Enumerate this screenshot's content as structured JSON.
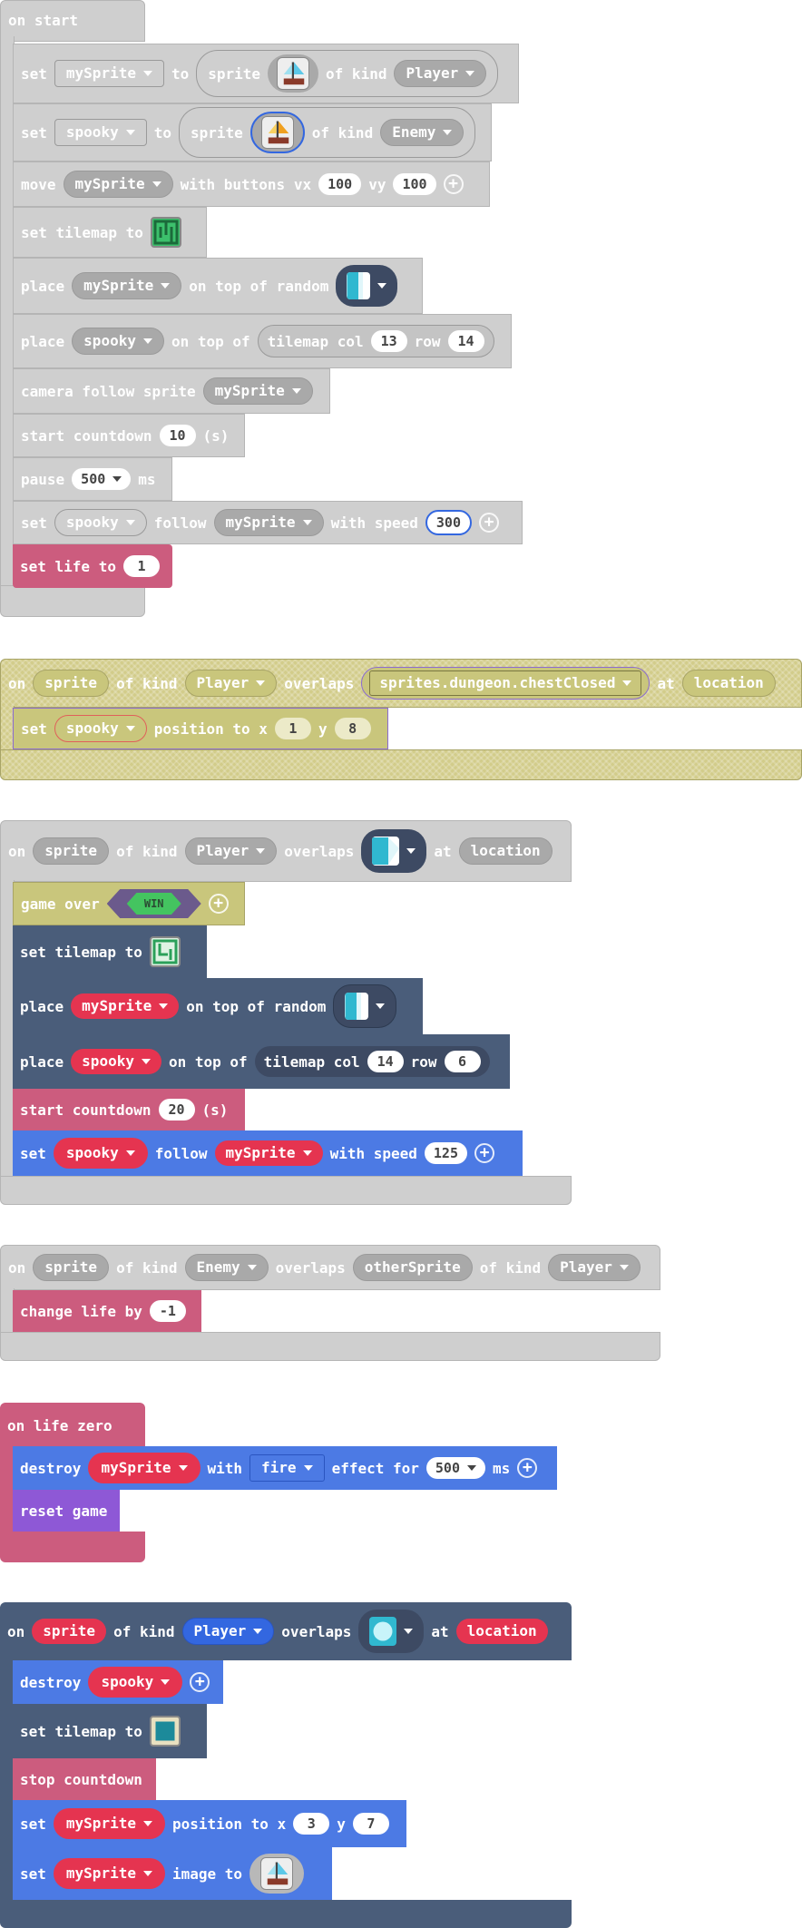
{
  "s1": {
    "hat": "on start",
    "set": "set",
    "to": "to",
    "sprite": "sprite",
    "of_kind": "of kind",
    "mySprite": "mySprite",
    "Player": "Player",
    "spooky": "spooky",
    "Enemy": "Enemy",
    "move": "move",
    "with_buttons": "with buttons vx",
    "vx": "100",
    "vy_lbl": "vy",
    "vy": "100",
    "set_tilemap": "set tilemap to",
    "place": "place",
    "on_top_random": "on top of random",
    "on_top_of": "on top of",
    "tilemap_col": "tilemap col",
    "col": "13",
    "row_lbl": "row",
    "row": "14",
    "camera": "camera follow sprite",
    "start_countdown": "start countdown",
    "countdown": "10",
    "s": "(s)",
    "pause": "pause",
    "pause_val": "500",
    "ms": "ms",
    "follow": "follow",
    "with_speed": "with speed",
    "speed": "300",
    "set_life": "set life to",
    "life": "1"
  },
  "s2": {
    "on": "on",
    "sprite": "sprite",
    "of_kind": "of kind",
    "Player": "Player",
    "overlaps": "overlaps",
    "tile": "sprites.dungeon.chestClosed",
    "at": "at",
    "location": "location",
    "set": "set",
    "spooky": "spooky",
    "position_to_x": "position to x",
    "x": "1",
    "y_lbl": "y",
    "y": "8"
  },
  "s3": {
    "on": "on",
    "sprite": "sprite",
    "of_kind": "of kind",
    "Player": "Player",
    "overlaps": "overlaps",
    "at": "at",
    "location": "location",
    "game_over": "game over",
    "win": "WIN",
    "set_tilemap": "set tilemap to",
    "place": "place",
    "mySprite": "mySprite",
    "on_top_random": "on top of random",
    "spooky": "spooky",
    "on_top_of": "on top of",
    "tilemap_col": "tilemap col",
    "col": "14",
    "row_lbl": "row",
    "row": "6",
    "start_countdown": "start countdown",
    "countdown": "20",
    "s": "(s)",
    "set": "set",
    "follow": "follow",
    "with_speed": "with speed",
    "speed": "125"
  },
  "s4": {
    "on": "on",
    "sprite": "sprite",
    "of_kind": "of kind",
    "Enemy": "Enemy",
    "overlaps": "overlaps",
    "otherSprite": "otherSprite",
    "of_kind2": "of kind",
    "Player": "Player",
    "change_life": "change life by",
    "delta": "-1"
  },
  "s5": {
    "hat": "on life zero",
    "destroy": "destroy",
    "mySprite": "mySprite",
    "with": "with",
    "fire": "fire",
    "effect_for": "effect for",
    "ms_val": "500",
    "ms": "ms",
    "reset": "reset game"
  },
  "s6": {
    "on": "on",
    "sprite": "sprite",
    "of_kind": "of kind",
    "Player": "Player",
    "overlaps": "overlaps",
    "at": "at",
    "location": "location",
    "destroy": "destroy",
    "spooky": "spooky",
    "set_tilemap": "set tilemap to",
    "stop_countdown": "stop countdown",
    "set": "set",
    "mySprite": "mySprite",
    "position_to_x": "position to x",
    "x": "3",
    "y_lbl": "y",
    "y": "7",
    "image_to": "image to"
  },
  "colors": {
    "sprites_gray": "#cfcfcf",
    "info_pink": "#cc5c7e",
    "scene_slate": "#4a5d7a",
    "sprites_blue": "#4c7ae4",
    "game_purple": "#8e58d6",
    "disabled_olive": "#d2cc8a",
    "var_red": "#e53450"
  },
  "icons": [
    "boat-sprite-icon",
    "tilemap-thumbnail-icon",
    "tile-wall-icon",
    "plus-circle-icon",
    "dropdown-arrow-icon"
  ]
}
